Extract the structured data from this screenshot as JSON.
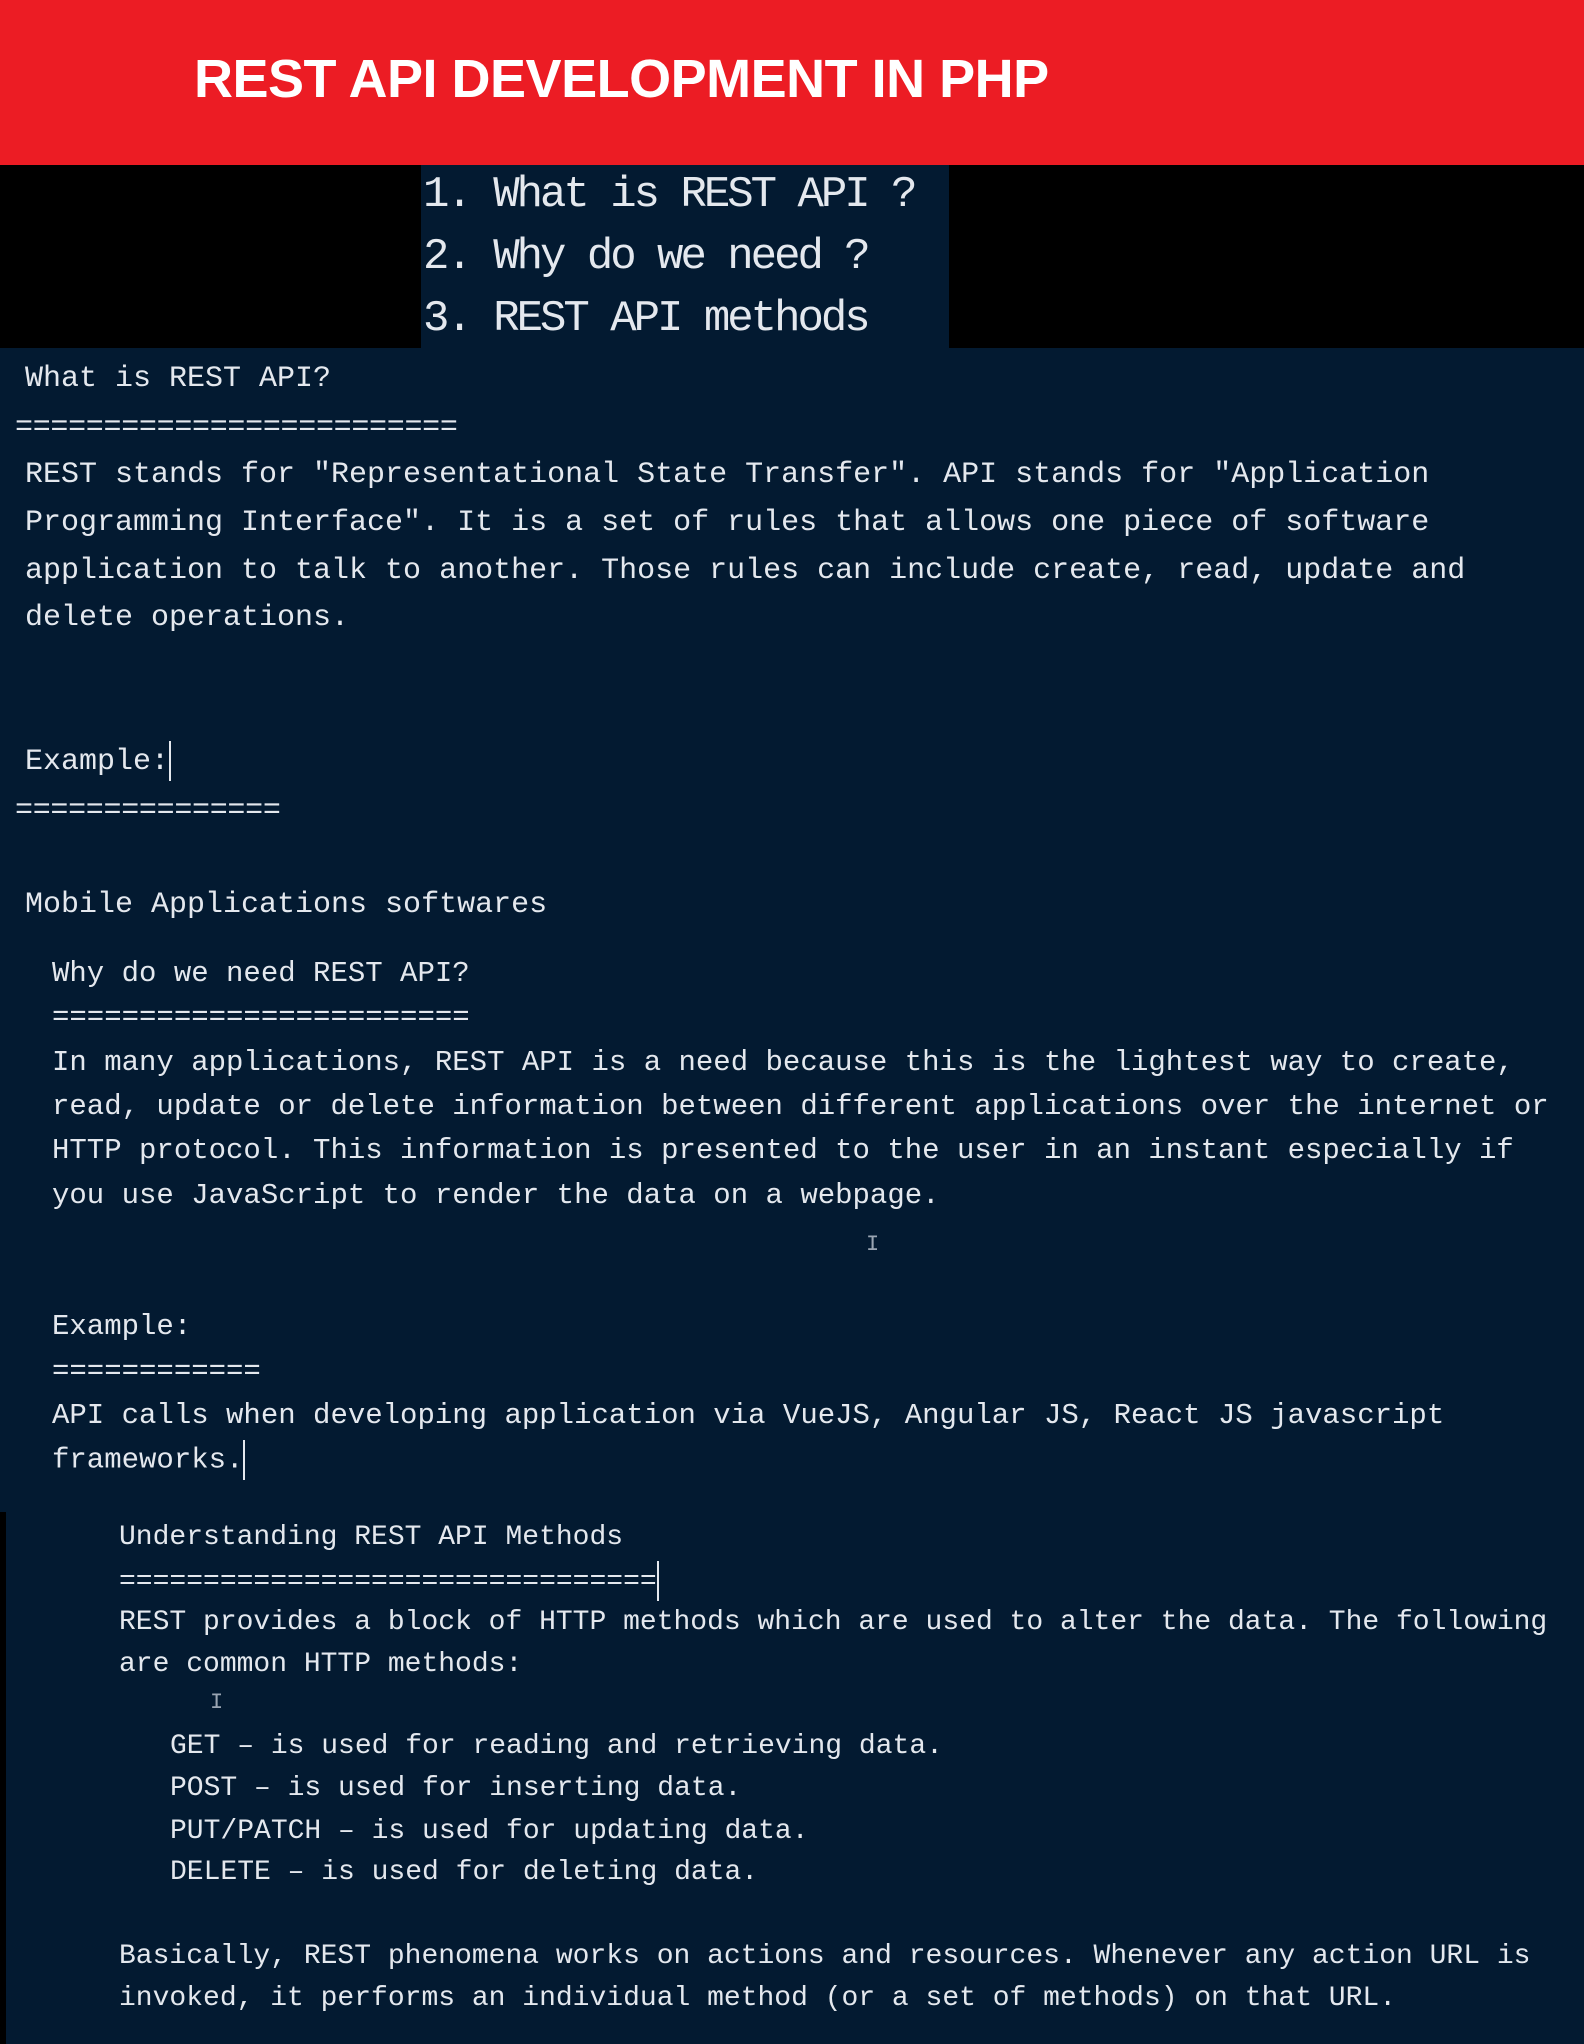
{
  "banner": {
    "title": "REST API DEVELOPMENT IN PHP"
  },
  "toc": [
    "1. What is REST API ?",
    "2. Why do we need ?",
    "3. REST API methods"
  ],
  "section1": {
    "heading": "What is REST API?",
    "rule": "=========================",
    "paragraph": [
      "REST stands for \"Representational State Transfer\". API stands for \"Application",
      "Programming Interface\". It is a set of rules that allows one piece of software",
      "application to talk to another. Those rules can include create, read, update and",
      "delete operations."
    ],
    "example_label": "Example:",
    "example_rule": "===============",
    "example_text": "Mobile Applications softwares"
  },
  "section2": {
    "heading": "Why do we need REST API?",
    "rule": "========================",
    "paragraph": [
      "In many applications, REST API is a need because this is the lightest way to create,",
      "read, update or delete information between different applications over the internet or",
      "HTTP protocol. This information is presented to the user in an instant especially if",
      "you use JavaScript to render the data on a webpage."
    ],
    "example_label": "Example:",
    "example_rule": "============",
    "example_text": [
      "API calls when developing application via VueJS, Angular JS, React JS javascript",
      "frameworks."
    ]
  },
  "section3": {
    "heading": "Understanding REST API Methods",
    "rule": "================================",
    "paragraph": [
      "REST provides a block of HTTP methods which are used to alter the data. The following",
      "are common HTTP methods:"
    ],
    "methods": [
      "GET – is used for reading and retrieving data.",
      "POST – is used for inserting data.",
      "PUT/PATCH – is used for updating data.",
      "DELETE – is used for deleting data."
    ],
    "closing": [
      "Basically, REST phenomena works on actions and resources. Whenever any action URL is",
      "invoked, it performs an individual method (or a set of methods) on that URL."
    ]
  },
  "colors": {
    "banner": "#ec1c24",
    "editor_bg": "#031a31",
    "text": "#e4e8ee"
  }
}
